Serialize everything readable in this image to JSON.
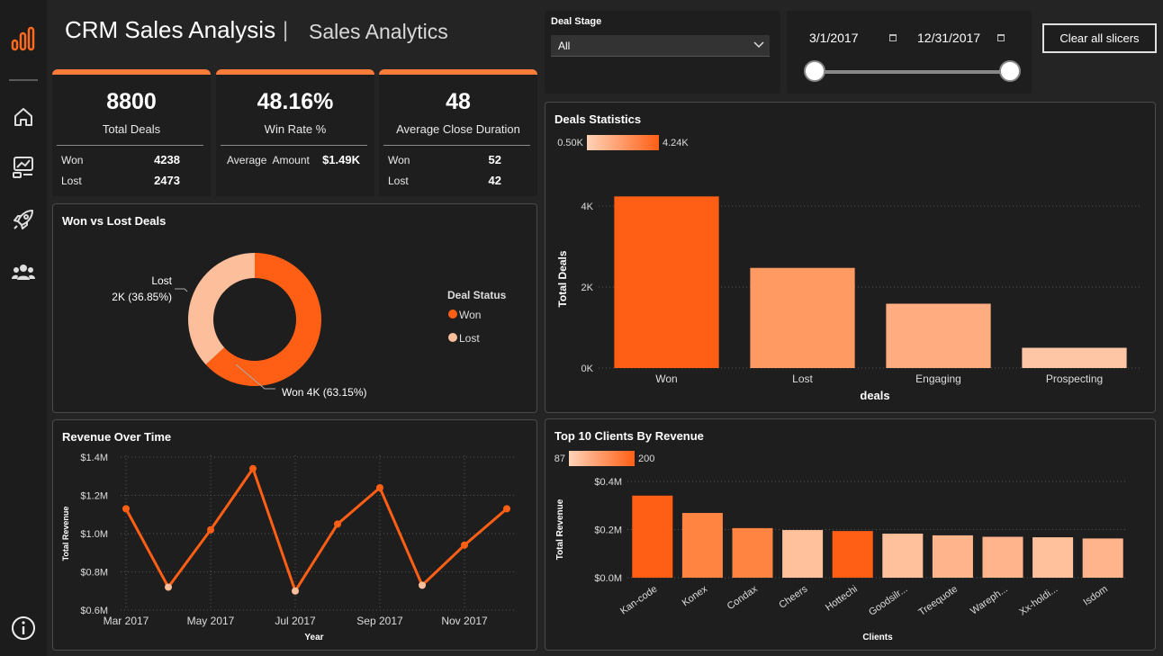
{
  "header": {
    "title": "CRM Sales Analysis",
    "separator": "|",
    "subtitle": "Sales Analytics"
  },
  "sidebar": {
    "items": [
      {
        "icon": "bar-chart-logo-icon"
      },
      {
        "icon": "home-icon"
      },
      {
        "icon": "dashboard-image-icon"
      },
      {
        "icon": "rocket-icon"
      },
      {
        "icon": "users-icon"
      },
      {
        "icon": "info-icon"
      }
    ]
  },
  "accent_color": "#ff5f15",
  "kpis": {
    "total_deals": {
      "value": "8800",
      "label": "Total Deals",
      "rows": [
        {
          "label": "Won",
          "value": "4238"
        },
        {
          "label": "Lost",
          "value": "2473"
        }
      ]
    },
    "win_rate": {
      "value": "48.16%",
      "label": "Win Rate %",
      "rows": [
        {
          "label": "Average  Amount",
          "value": "$1.49K"
        }
      ]
    },
    "close_duration": {
      "value": "48",
      "label": "Average Close Duration",
      "rows": [
        {
          "label": "Won",
          "value": "52"
        },
        {
          "label": "Lost",
          "value": "42"
        }
      ]
    }
  },
  "filters": {
    "deal_stage": {
      "label": "Deal Stage",
      "selected": "All"
    },
    "date_range": {
      "start": "3/1/2017",
      "end": "12/31/2017"
    },
    "clear_button": "Clear all slicers"
  },
  "panels": {
    "won_lost": "Won vs Lost Deals",
    "deals_stats": "Deals Statistics",
    "revenue_time": "Revenue Over Time",
    "top_clients": "Top 10 Clients By Revenue"
  },
  "chart_data": [
    {
      "id": "won_lost",
      "type": "pie",
      "title": "Won vs Lost Deals",
      "legend_title": "Deal Status",
      "legend_position": "right",
      "slices": [
        {
          "name": "Won",
          "value": 63.15,
          "label": "Won 4K (63.15%)",
          "color": "#ff5f15"
        },
        {
          "name": "Lost",
          "value": 36.85,
          "label_line1": "Lost",
          "label_line2": "2K (36.85%)",
          "color": "#fdbf9b"
        }
      ]
    },
    {
      "id": "deals_stats",
      "type": "bar",
      "title": "Deals Statistics",
      "gradient_min": "0.50K",
      "gradient_max": "4.24K",
      "xlabel": "deals",
      "ylabel": "Total Deals",
      "categories": [
        "Won",
        "Lost",
        "Engaging",
        "Prospecting"
      ],
      "values": [
        4238,
        2473,
        1589,
        500
      ],
      "colors": [
        "#ff5f15",
        "#ff9a63",
        "#ffad80",
        "#ffc6a5"
      ],
      "yticks": [
        {
          "v": 0,
          "t": "0K"
        },
        {
          "v": 2000,
          "t": "2K"
        },
        {
          "v": 4000,
          "t": "4K"
        }
      ],
      "ylim": [
        0,
        4400
      ],
      "grid": true
    },
    {
      "id": "revenue_time",
      "type": "line",
      "title": "Revenue Over Time",
      "xlabel": "Year",
      "ylabel": "Total Revenue",
      "x": [
        "Mar 2017",
        "Apr 2017",
        "May 2017",
        "Jun 2017",
        "Jul 2017",
        "Aug 2017",
        "Sep 2017",
        "Oct 2017",
        "Nov 2017",
        "Dec 2017"
      ],
      "xtick_labels": [
        "Mar 2017",
        "May 2017",
        "Jul 2017",
        "Sep 2017",
        "Nov 2017"
      ],
      "values": [
        1.13,
        0.72,
        1.02,
        1.34,
        0.7,
        1.05,
        1.24,
        0.73,
        0.94,
        1.13
      ],
      "point_colors": [
        "#ff5f15",
        "#fdbf9b",
        "#ff5f15",
        "#ff5f15",
        "#fdbf9b",
        "#ff5f15",
        "#ff5f15",
        "#fdbf9b",
        "#ff5f15",
        "#ff5f15"
      ],
      "yticks": [
        {
          "v": 0.6,
          "t": "$0.6M"
        },
        {
          "v": 0.8,
          "t": "$0.8M"
        },
        {
          "v": 1.0,
          "t": "$1.0M"
        },
        {
          "v": 1.2,
          "t": "$1.2M"
        },
        {
          "v": 1.4,
          "t": "$1.4M"
        }
      ],
      "ylim": [
        0.6,
        1.4
      ],
      "grid": true
    },
    {
      "id": "top_clients",
      "type": "bar",
      "title": "Top 10 Clients By Revenue",
      "gradient_min": "87",
      "gradient_max": "200",
      "xlabel": "Clients",
      "ylabel": "Total Revenue",
      "categories": [
        "Kan-code",
        "Konex",
        "Condax",
        "Cheers",
        "Hottechi",
        "Goodsilr...",
        "Treequote",
        "Wareph...",
        "Xx-holdi...",
        "Isdom"
      ],
      "values": [
        0.341,
        0.269,
        0.206,
        0.198,
        0.194,
        0.183,
        0.176,
        0.17,
        0.168,
        0.163
      ],
      "colors": [
        "#ff5f15",
        "#ff8442",
        "#ff8442",
        "#ffc09c",
        "#ff5f15",
        "#ffc09c",
        "#ffb48c",
        "#ffb48c",
        "#ffc09c",
        "#ffb48c"
      ],
      "yticks": [
        {
          "v": 0,
          "t": "$0.0M"
        },
        {
          "v": 0.2,
          "t": "$0.2M"
        },
        {
          "v": 0.4,
          "t": "$0.4M"
        }
      ],
      "ylim": [
        0,
        0.4
      ],
      "grid": true
    }
  ]
}
